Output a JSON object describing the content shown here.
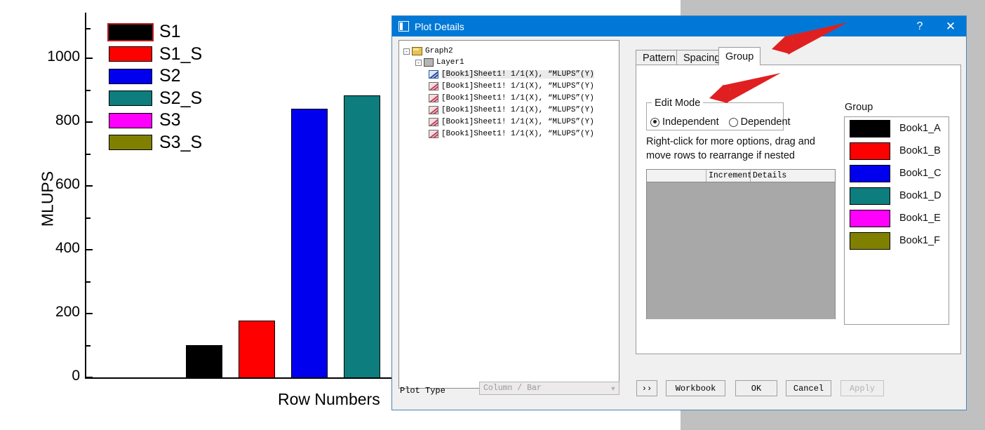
{
  "chart_data": {
    "type": "bar",
    "title": "",
    "xlabel": "Row Numbers",
    "ylabel": "MLUPS",
    "categories": [
      "S1",
      "S1_S",
      "S2",
      "S2_S",
      "S3",
      "S3_S"
    ],
    "values": [
      100,
      178,
      840,
      880,
      null,
      null
    ],
    "ylim": [
      0,
      1100
    ],
    "ytick_labels": [
      "0",
      "200",
      "400",
      "600",
      "800",
      "1000"
    ],
    "ytick_values": [
      0,
      200,
      400,
      600,
      800,
      1000
    ],
    "grid": false,
    "legend_position": "upper-left",
    "series_colors": [
      "#000000",
      "#FF0000",
      "#0000EE",
      "#0d7d7d",
      "#FF00FF",
      "#808000"
    ],
    "legend": [
      {
        "label": "S1",
        "color": "#000000",
        "selected": true
      },
      {
        "label": "S1_S",
        "color": "#FF0000",
        "selected": false
      },
      {
        "label": "S2",
        "color": "#0000EE",
        "selected": false
      },
      {
        "label": "S2_S",
        "color": "#0d7d7d",
        "selected": false
      },
      {
        "label": "S3",
        "color": "#FF00FF",
        "selected": false
      },
      {
        "label": "S3_S",
        "color": "#808000",
        "selected": false
      }
    ]
  },
  "dialog": {
    "title": "Plot Details",
    "help_label": "?",
    "close_label": "✕",
    "tabs": [
      {
        "label": "Pattern",
        "active": false
      },
      {
        "label": "Spacing",
        "active": false
      },
      {
        "label": "Group",
        "active": true
      }
    ],
    "tree": {
      "root": "Graph2",
      "layer": "Layer1",
      "plots": [
        "[Book1]Sheet1! 1/1(X), “MLUPS”(Y)",
        "[Book1]Sheet1! 1/1(X), “MLUPS”(Y)",
        "[Book1]Sheet1! 1/1(X), “MLUPS”(Y)",
        "[Book1]Sheet1! 1/1(X), “MLUPS”(Y)",
        "[Book1]Sheet1! 1/1(X), “MLUPS”(Y)",
        "[Book1]Sheet1! 1/1(X), “MLUPS”(Y)"
      ]
    },
    "group_tab": {
      "edit_mode_label": "Edit Mode",
      "radios": [
        {
          "label": "Independent",
          "checked": true
        },
        {
          "label": "Dependent",
          "checked": false
        }
      ],
      "hint_line1": "Right-click for more options, drag and",
      "hint_line2": "move rows to  rearrange if nested",
      "increment_table": {
        "columns": [
          "",
          "Increment",
          "Details"
        ],
        "rows": []
      },
      "group_label": "Group",
      "group_items": [
        {
          "name": "Book1_A",
          "color": "#000000"
        },
        {
          "name": "Book1_B",
          "color": "#FF0000"
        },
        {
          "name": "Book1_C",
          "color": "#0000EE"
        },
        {
          "name": "Book1_D",
          "color": "#0d7d7d"
        },
        {
          "name": "Book1_E",
          "color": "#FF00FF"
        },
        {
          "name": "Book1_F",
          "color": "#808000"
        }
      ]
    },
    "footer": {
      "plot_type_label": "Plot Type",
      "plot_type_value": "Column / Bar",
      "expand_label": "››",
      "workbook_label": "Workbook",
      "ok_label": "OK",
      "cancel_label": "Cancel",
      "apply_label": "Apply",
      "apply_disabled": true
    }
  },
  "annotations": {
    "arrow_color": "#e02020",
    "arrow_count": 2
  }
}
